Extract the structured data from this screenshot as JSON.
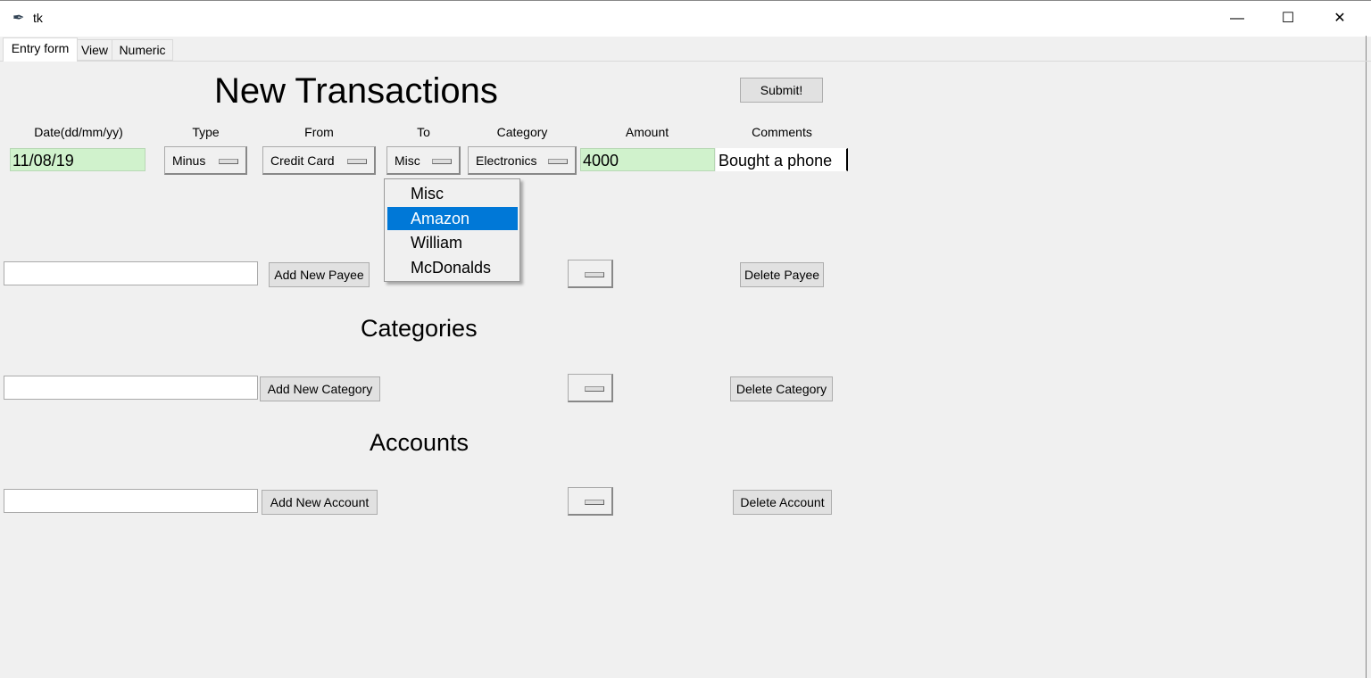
{
  "window": {
    "title": "tk"
  },
  "tabs": [
    {
      "label": "Entry form",
      "selected": true
    },
    {
      "label": "View"
    },
    {
      "label": "Numeric"
    }
  ],
  "form": {
    "title": "New Transactions",
    "submit_label": "Submit!",
    "headers": {
      "date": "Date(dd/mm/yy)",
      "type": "Type",
      "from": "From",
      "to": "To",
      "category": "Category",
      "amount": "Amount",
      "comments": "Comments"
    },
    "values": {
      "date": "11/08/19",
      "type": "Minus",
      "from": "Credit Card",
      "to": "Misc",
      "category": "Electronics",
      "amount": "4000",
      "comments": "Bought a phone"
    }
  },
  "to_menu": {
    "items": [
      "Misc",
      "Amazon",
      "William",
      "McDonalds"
    ],
    "highlighted": "Amazon",
    "highlight_color": "#0078d7"
  },
  "payees": {
    "input": "",
    "add_label": "Add New Payee",
    "delete_label": "Delete Payee"
  },
  "categories": {
    "heading": "Categories",
    "input": "",
    "add_label": "Add New Category",
    "delete_label": "Delete Category"
  },
  "accounts": {
    "heading": "Accounts",
    "input": "",
    "add_label": "Add New Account",
    "delete_label": "Delete Account"
  }
}
